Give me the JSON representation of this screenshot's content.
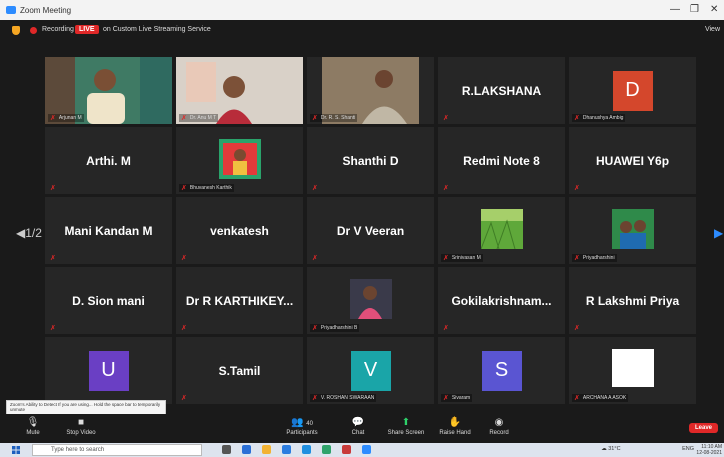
{
  "window": {
    "title": "Zoom Meeting"
  },
  "topbar": {
    "recording": "Recording",
    "live": "LIVE",
    "streaming": "on Custom Live Streaming Service",
    "view": "View"
  },
  "pager": {
    "page": "1/2"
  },
  "tiles": [
    {
      "name": "",
      "caption": "Arjunan M"
    },
    {
      "name": "",
      "caption": "Dr. Anu M T"
    },
    {
      "name": "",
      "caption": "Dr. R. S. Shanti"
    },
    {
      "name": "R.LAKSHANA",
      "caption": ""
    },
    {
      "name": "",
      "caption": "Dhanushya Ambig",
      "avatar": "D"
    },
    {
      "name": "Arthi. M",
      "caption": ""
    },
    {
      "name": "",
      "caption": "Bhuvanesh Karthik"
    },
    {
      "name": "Shanthi D",
      "caption": ""
    },
    {
      "name": "Redmi Note 8",
      "caption": ""
    },
    {
      "name": "HUAWEI Y6p",
      "caption": ""
    },
    {
      "name": "Mani Kandan M",
      "caption": ""
    },
    {
      "name": "venkatesh",
      "caption": ""
    },
    {
      "name": "Dr V Veeran",
      "caption": ""
    },
    {
      "name": "",
      "caption": "Srinivasan M"
    },
    {
      "name": "",
      "caption": "Priyadharshini"
    },
    {
      "name": "D. Sion mani",
      "caption": ""
    },
    {
      "name": "Dr R KARTHIKEY...",
      "caption": ""
    },
    {
      "name": "",
      "caption": "Priyadharshini B"
    },
    {
      "name": "Gokilakrishnam...",
      "caption": ""
    },
    {
      "name": "R Lakshmi Priya",
      "caption": ""
    },
    {
      "name": "",
      "caption": "",
      "avatar": "U"
    },
    {
      "name": "S.Tamil",
      "caption": ""
    },
    {
      "name": "",
      "caption": "V. ROSHAN SWARAAN",
      "avatar": "V"
    },
    {
      "name": "",
      "caption": "Sivaram",
      "avatar": "S"
    },
    {
      "name": "",
      "caption": "ARCHANA A ASOK"
    }
  ],
  "toast": {
    "text": "Zoom's Ability to Detect If you are using... Hold the space bar to temporarily unmute"
  },
  "toolbar": {
    "mute": "Mute",
    "stop_video": "Stop Video",
    "participants": "Participants",
    "participants_count": "40",
    "chat": "Chat",
    "share": "Share Screen",
    "raise": "Raise Hand",
    "record": "Record",
    "leave": "Leave"
  },
  "taskbar": {
    "search": "Type here to search",
    "weather": "31°C",
    "lang": "ENG",
    "time": "11:10 AM",
    "date": "12-08-2021"
  },
  "colors": {
    "speaking": "#c9de3a",
    "accent": "#2d8cff",
    "live": "#e02828",
    "avatar_d": "#d4472c",
    "avatar_u": "#6a3fc4",
    "avatar_v": "#1aa5a8",
    "avatar_s": "#5a55d2"
  }
}
